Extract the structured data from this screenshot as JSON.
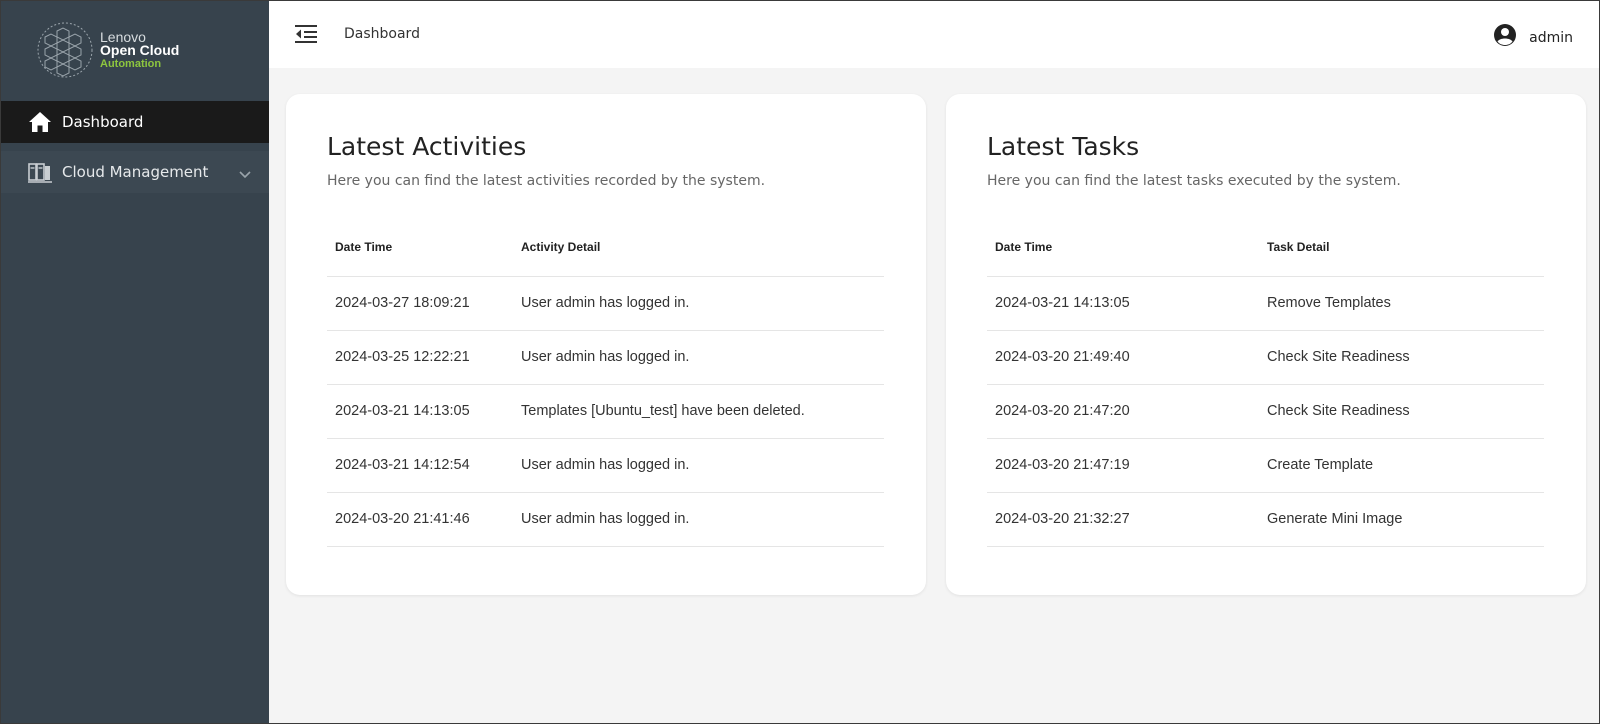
{
  "logo": {
    "line1": "Lenovo",
    "line2": "Open Cloud",
    "line3": "Automation"
  },
  "sidebar": {
    "items": [
      {
        "label": "Dashboard",
        "icon": "home-icon"
      },
      {
        "label": "Cloud Management",
        "icon": "cloud-management-icon"
      }
    ]
  },
  "header": {
    "breadcrumb": "Dashboard",
    "user": "admin"
  },
  "activities": {
    "title": "Latest Activities",
    "subtitle": "Here you can find the latest activities recorded by the system.",
    "columns": [
      "Date Time",
      "Activity Detail"
    ],
    "rows": [
      [
        "2024-03-27 18:09:21",
        "User admin has logged in."
      ],
      [
        "2024-03-25 12:22:21",
        "User admin has logged in."
      ],
      [
        "2024-03-21 14:13:05",
        "Templates [Ubuntu_test] have been deleted."
      ],
      [
        "2024-03-21 14:12:54",
        "User admin has logged in."
      ],
      [
        "2024-03-20 21:41:46",
        "User admin has logged in."
      ]
    ]
  },
  "tasks": {
    "title": "Latest Tasks",
    "subtitle": "Here you can find the latest tasks executed by the system.",
    "columns": [
      "Date Time",
      "Task Detail"
    ],
    "rows": [
      [
        "2024-03-21 14:13:05",
        "Remove Templates"
      ],
      [
        "2024-03-20 21:49:40",
        "Check Site Readiness"
      ],
      [
        "2024-03-20 21:47:20",
        "Check Site Readiness"
      ],
      [
        "2024-03-20 21:47:19",
        "Create Template"
      ],
      [
        "2024-03-20 21:32:27",
        "Generate Mini Image"
      ]
    ]
  },
  "colors": {
    "sidebar": "#37434d",
    "active_nav": "#1a1a1a",
    "brand_green": "#8dc63f",
    "background": "#f4f4f4"
  }
}
